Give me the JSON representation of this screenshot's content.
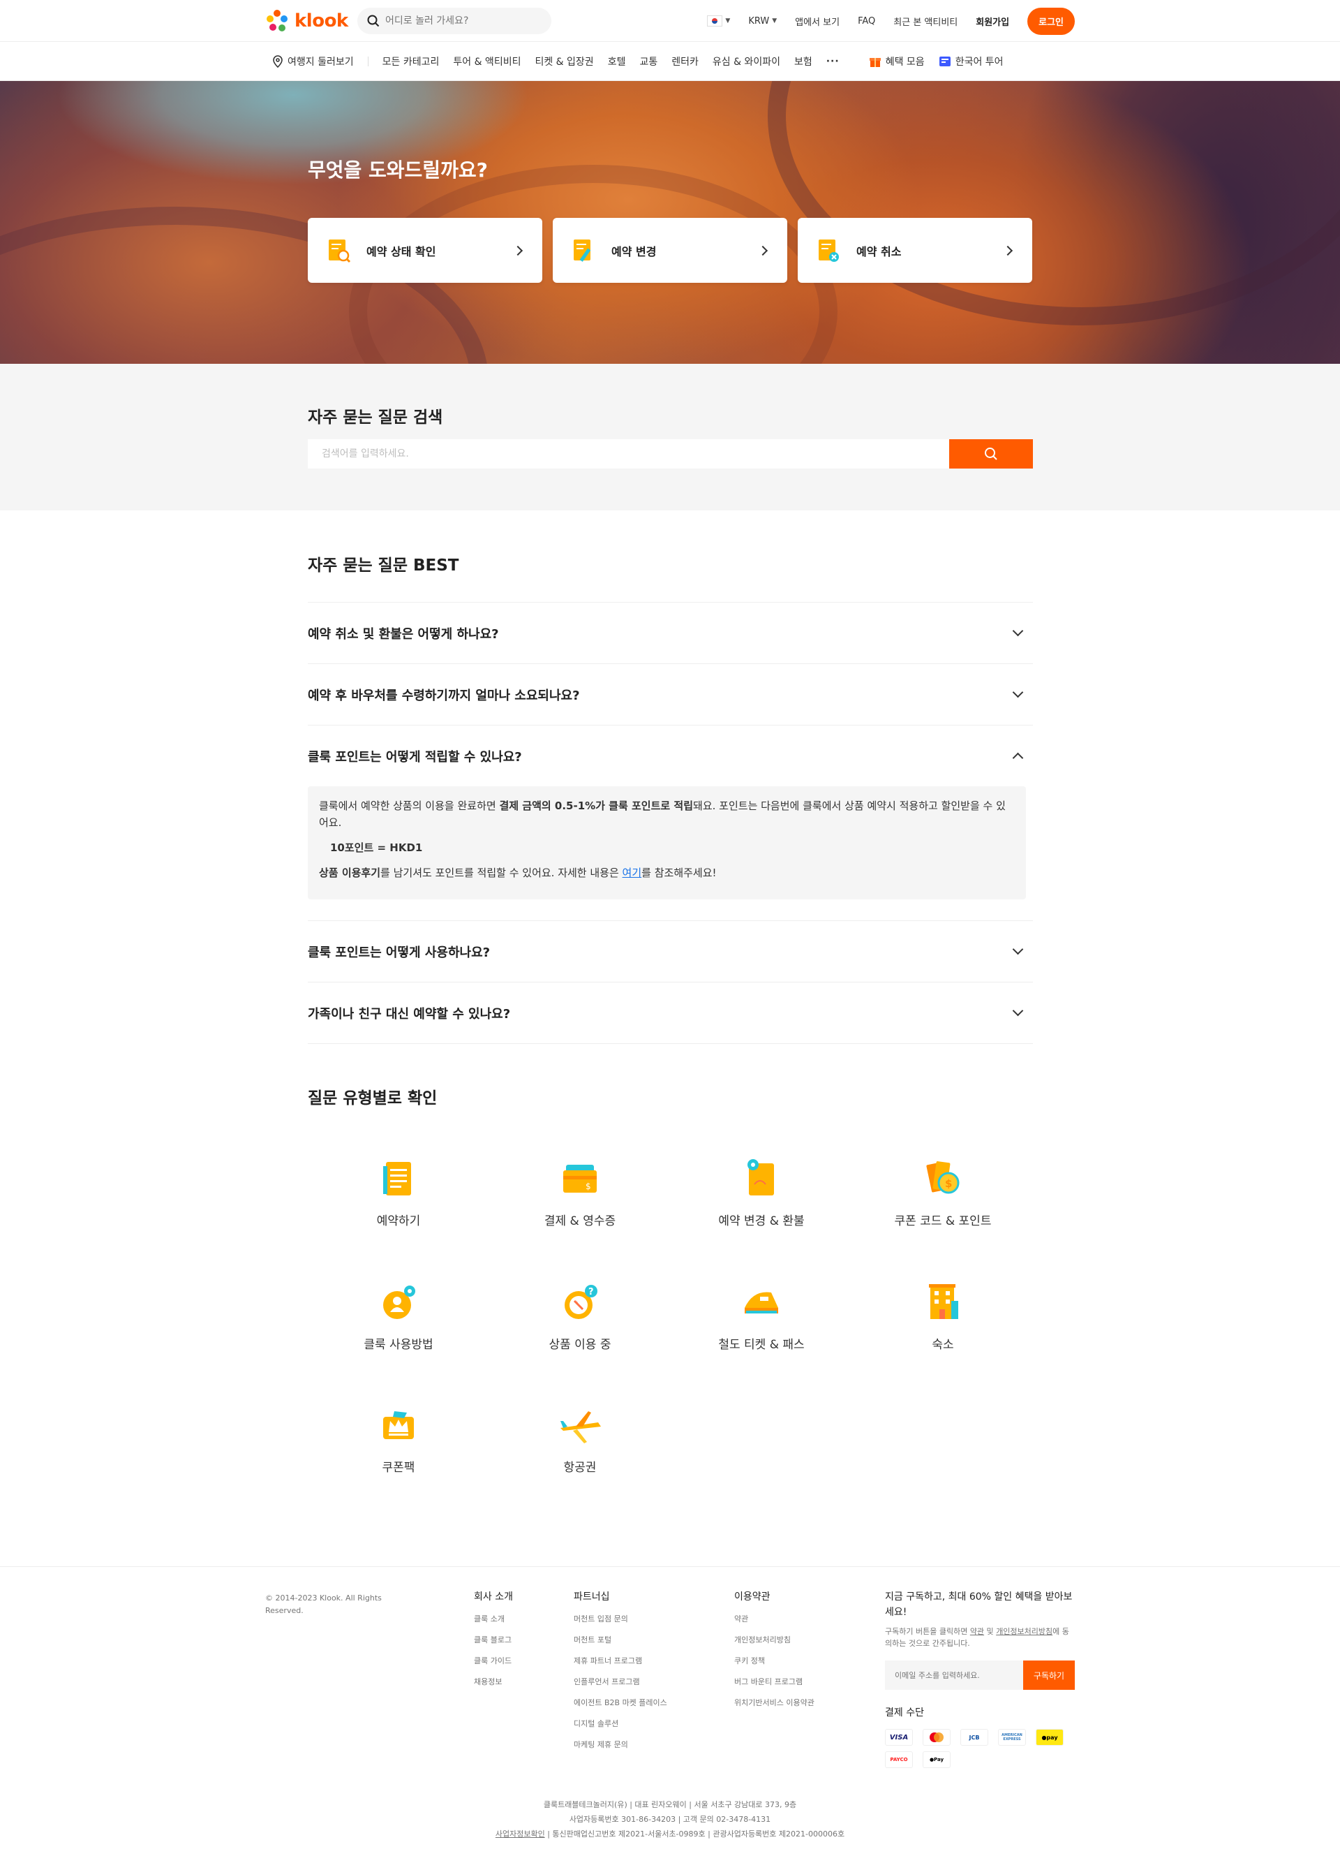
{
  "header": {
    "logo_text": "klook",
    "search_placeholder": "어디로 놀러 가세요?",
    "currency": "KRW",
    "items": [
      "앱에서 보기",
      "FAQ",
      "최근 본 액티비티"
    ],
    "signup": "회원가입",
    "login": "로그인"
  },
  "nav": {
    "items": [
      "여행지 둘러보기",
      "모든 카테고리",
      "투어 & 액티비티",
      "티켓 & 입장권",
      "호텔",
      "교통",
      "렌터카",
      "유심 & 와이파이",
      "보험"
    ],
    "more": "···",
    "deals": "혜택 모음",
    "korean_tour": "한국어 투어"
  },
  "hero": {
    "title": "무엇을 도와드릴까요?",
    "actions": [
      "예약 상태 확인",
      "예약 변경",
      "예약 취소"
    ]
  },
  "faq_search": {
    "title": "자주 묻는 질문 검색",
    "placeholder": "검색어를 입력하세요."
  },
  "faq_best": {
    "title": "자주 묻는 질문 BEST",
    "questions": [
      "예약 취소 및 환불은 어떻게 하나요?",
      "예약 후 바우처를 수령하기까지 얼마나 소요되나요?",
      "클룩 포인트는 어떻게 적립할 수 있나요?",
      "클룩 포인트는 어떻게 사용하나요?",
      "가족이나 친구 대신 예약할 수 있나요?"
    ],
    "answer": {
      "p1_a": "클룩에서 예약한 상품의 이용을 완료하면 ",
      "p1_b": "결제 금액의 0.5-1%가 클룩 포인트로 적립",
      "p1_c": "돼요. 포인트는 다음번에 클룩에서 상품 예약시 적용하고 할인받을 수 있어요.",
      "rate": "10포인트 = HKD1",
      "p3_a": "상품 이용후기",
      "p3_b": "를 남기셔도 포인트를 적립할 수 있어요. 자세한 내용은 ",
      "p3_link": "여기",
      "p3_c": "를 참조해주세요!"
    }
  },
  "categories": {
    "title": "질문 유형별로 확인",
    "items": [
      "예약하기",
      "결제 & 영수증",
      "예약 변경 & 환불",
      "쿠폰 코드 & 포인트",
      "클룩 사용방법",
      "상품 이용 중",
      "철도 티켓 & 패스",
      "숙소",
      "쿠폰팩",
      "항공권"
    ]
  },
  "footer": {
    "copyright": "© 2014-2023 Klook. All Rights Reserved.",
    "col1": {
      "title": "회사 소개",
      "items": [
        "클룩 소개",
        "클룩 블로그",
        "클룩 가이드",
        "채용정보"
      ]
    },
    "col2": {
      "title": "파트너십",
      "items": [
        "머천트 입점 문의",
        "머천트 포털",
        "제휴 파트너 프로그램",
        "인플루언서 프로그램",
        "에이전트 B2B 마켓 플레이스",
        "디지털 솔루션",
        "마케팅 제휴 문의"
      ]
    },
    "col3": {
      "title": "이용약관",
      "items": [
        "약관",
        "개인정보처리방침",
        "쿠키 정책",
        "버그 바운티 프로그램",
        "위치기반서비스 이용약관"
      ]
    },
    "subscribe": {
      "title": "지금 구독하고, 최대 60% 할인 혜택을 받아보세요!",
      "note_a": "구독하기 버튼을 클릭하면 ",
      "note_link1": "약관",
      "note_b": " 및 ",
      "note_link2": "개인정보처리방침",
      "note_c": "에 동의하는 것으로 간주됩니다.",
      "placeholder": "이메일 주소를 입력하세요.",
      "button": "구독하기"
    },
    "payment_title": "결제 수단",
    "payments": [
      "VISA",
      "mastercard",
      "JCB",
      "AMERICAN EXPRESS",
      "kakaopay",
      "PAYCO",
      "Apple Pay"
    ],
    "bottom_lines": [
      "클룩트래블테크놀러지(유) | 대표 린자오웨이 | 서울 서초구 강남대로 373, 9층",
      "사업자등록번호 301-86-34203 | 고객 문의 02-3478-4131"
    ],
    "bottom_link": "사업자정보확인",
    "bottom_last": " | 통신판매업신고번호 제2021-서울서초-0989호 | 관광사업자등록번호 제2021-000006호"
  }
}
